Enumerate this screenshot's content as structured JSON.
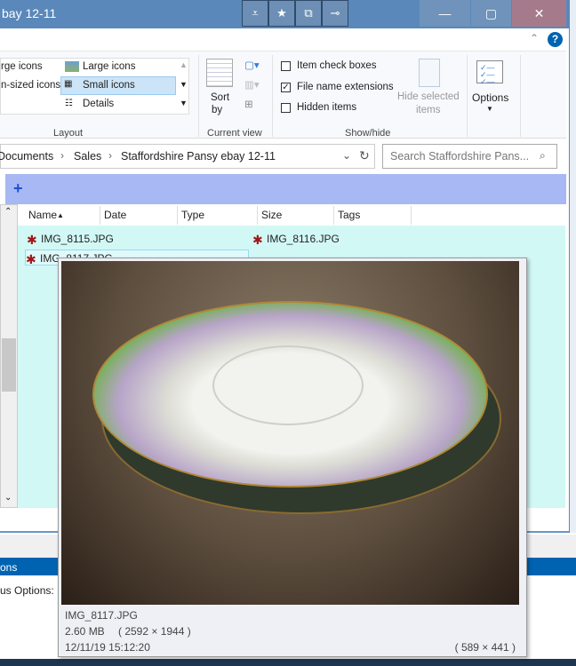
{
  "window": {
    "title": "bay 12-11",
    "quick_access": [
      "customize-icon",
      "pin-icon",
      "properties-icon",
      "pin-to-start-icon"
    ],
    "controls": {
      "minimize": "—",
      "maximize": "▢",
      "close": "✕"
    }
  },
  "ribbon": {
    "layout": {
      "items": [
        "rge icons",
        "Large icons",
        "n-sized icons",
        "Small icons",
        "Details"
      ],
      "label": "Layout",
      "selected": "Small icons"
    },
    "current_view": {
      "sort_label": "Sort",
      "sort_by": "by",
      "label": "Current view"
    },
    "show_hide": {
      "item_check_boxes": "Item check boxes",
      "file_name_extensions": "File name extensions",
      "hidden_items": "Hidden items",
      "hide_selected": "Hide selected",
      "hide_selected2": "items",
      "label": "Show/hide",
      "checked": {
        "item_check_boxes": false,
        "file_name_extensions": true,
        "hidden_items": false
      }
    },
    "options": "Options"
  },
  "address": {
    "crumbs": [
      "Documents",
      "Sales",
      "Staffordshire Pansy ebay 12-11"
    ],
    "search_placeholder": "Search Staffordshire Pans..."
  },
  "columns": [
    "Name",
    "Date",
    "Type",
    "Size",
    "Tags"
  ],
  "files": [
    "IMG_8115.JPG",
    "IMG_8116.JPG",
    "IMG_8117.JPG"
  ],
  "background_window": {
    "tab": "ons",
    "label": "us Options:"
  },
  "tooltip": {
    "name": "IMG_8117.JPG",
    "size": "2.60 MB",
    "dimensions": "( 2592 × 1944 )",
    "date": "12/11/19 15:12:20",
    "preview_size": "( 589 × 441 )"
  },
  "colors": {
    "titlebar": "#5a88ba",
    "band": "#a8b8f4",
    "content": "#d2f8f6",
    "accent": "#0063b1"
  }
}
